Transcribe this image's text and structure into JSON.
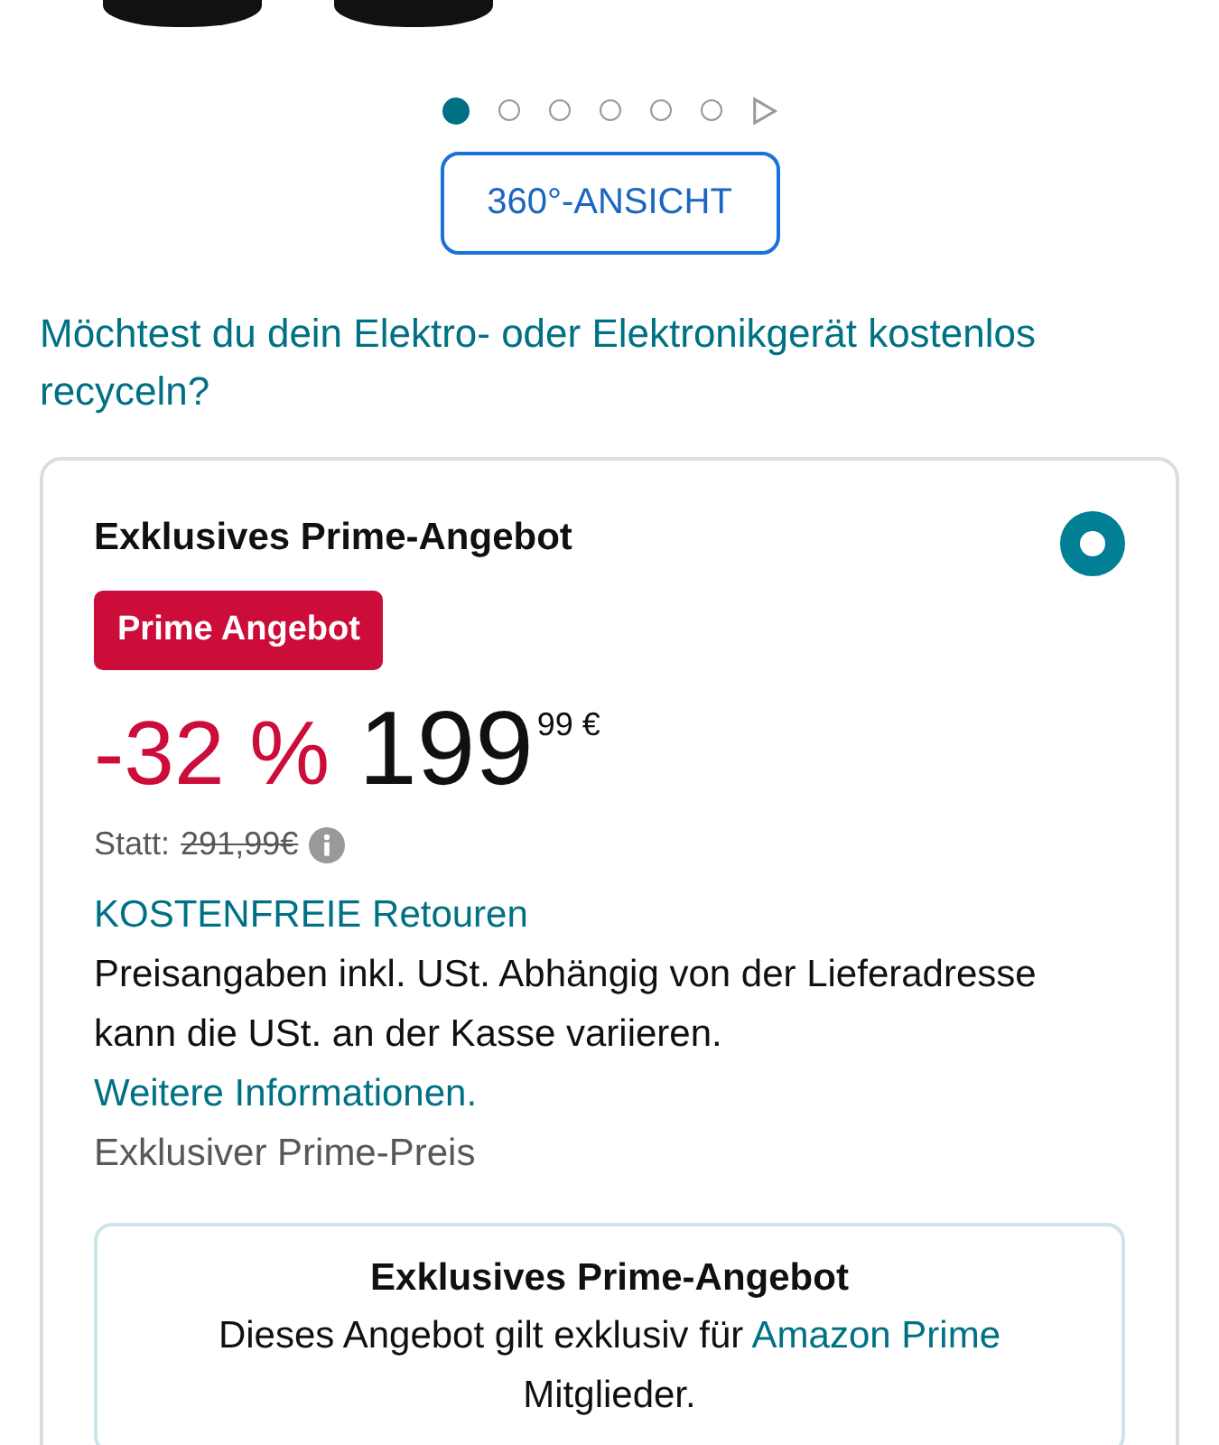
{
  "carousel": {
    "dots": [
      {
        "selected": true
      },
      {
        "selected": false
      },
      {
        "selected": false
      },
      {
        "selected": false
      },
      {
        "selected": false
      },
      {
        "selected": false
      }
    ]
  },
  "view_button": "360°-ANSICHT",
  "recycle_link": "Möchtest du dein Elektro- oder Elektronikgerät kostenlos recyceln?",
  "offer": {
    "title": "Exklusives Prime-Angebot",
    "selected": true,
    "badge": "Prime Angebot",
    "discount": "-32 %",
    "price_whole": "199",
    "price_fraction": "99",
    "currency": "€",
    "was_label": "Statt:",
    "was_price": "291,99€",
    "returns_link": "KOSTENFREIE Retouren",
    "tax_note": "Preisangaben inkl. USt. Abhängig von der Lieferadresse kann die USt. an der Kasse variieren.",
    "more_link": "Weitere Informationen.",
    "price_type": "Exklusiver Prime-Preis",
    "info_box": {
      "title": "Exklusives Prime-Angebot",
      "text_before": "Dieses Angebot gilt exklusiv für",
      "link": "Amazon Prime",
      "text_after": "Mitglieder."
    }
  }
}
